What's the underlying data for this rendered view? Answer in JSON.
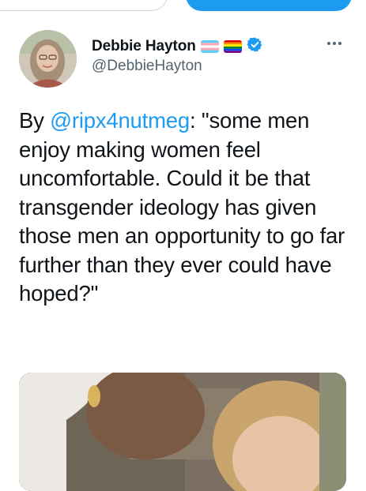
{
  "header": {
    "left_button_label": "",
    "right_button_label": ""
  },
  "tweet": {
    "author": {
      "display_name": "Debbie Hayton",
      "handle": "@DebbieHayton",
      "badges": [
        "transgender-flag-icon",
        "rainbow-flag-icon",
        "verified-badge-icon"
      ]
    },
    "text": {
      "prefix": "By ",
      "mention": "@ripx4nutmeg",
      "body": ": \"some men enjoy making women feel uncomfortable. Could it be that transgender ideology has given those men an opportunity to go far further than they ever could have hoped?\""
    },
    "media": {
      "type": "photo"
    }
  },
  "colors": {
    "accent": "#1d9bf0",
    "text": "#0f1419",
    "secondary_text": "#536471",
    "verified": "#1d9bf0"
  }
}
